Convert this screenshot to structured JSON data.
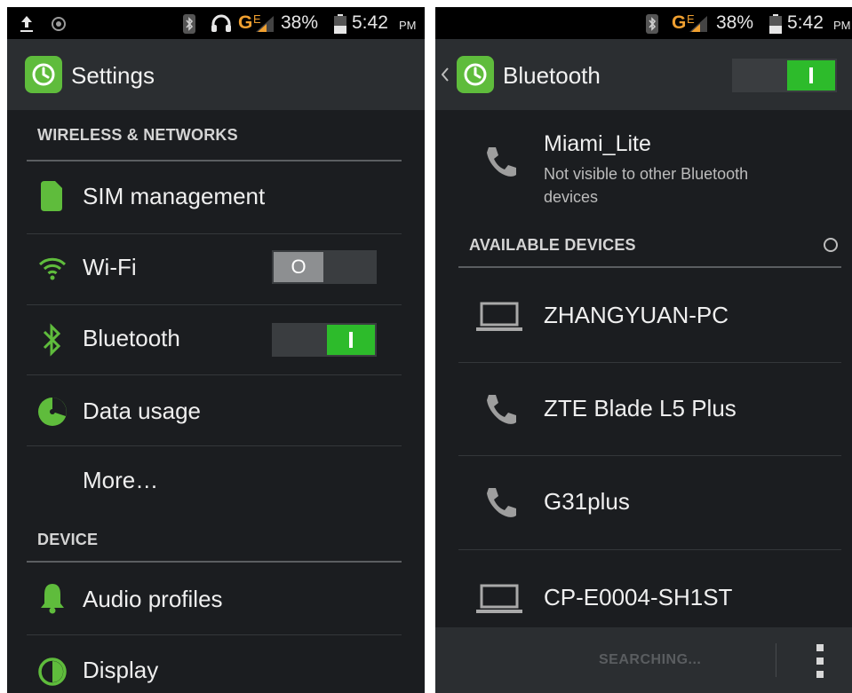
{
  "left": {
    "status": {
      "battery": "38%",
      "time": "5:42",
      "ampm": "PM",
      "network": "G",
      "network_sup": "E"
    },
    "title": "Settings",
    "sections": {
      "wireless": "WIRELESS & NETWORKS",
      "device": "DEVICE"
    },
    "items": {
      "sim": "SIM management",
      "wifi": "Wi-Fi",
      "bluetooth": "Bluetooth",
      "data": "Data usage",
      "more": "More…",
      "audio": "Audio profiles",
      "display": "Display"
    },
    "wifi_toggle_text": "O",
    "wifi_enabled": false,
    "bluetooth_enabled": true
  },
  "right": {
    "status": {
      "battery": "38%",
      "time": "5:42",
      "ampm": "PM",
      "network": "G",
      "network_sup": "E"
    },
    "title": "Bluetooth",
    "bluetooth_enabled": true,
    "this_device": {
      "name": "Miami_Lite",
      "subtitle_line1": "Not visible to other Bluetooth",
      "subtitle_line2": "devices"
    },
    "available_header": "AVAILABLE DEVICES",
    "devices": [
      {
        "name": "ZHANGYUAN-PC",
        "icon": "laptop-icon"
      },
      {
        "name": "ZTE Blade L5 Plus",
        "icon": "phone-icon"
      },
      {
        "name": "G31plus",
        "icon": "phone-icon"
      },
      {
        "name": "CP-E0004-SH1ST",
        "icon": "laptop-icon"
      }
    ],
    "searching_label": "SEARCHING..."
  },
  "colors": {
    "accent_green": "#5fbc3c",
    "toggle_on": "#2dbb2b",
    "background": "#1b1d20",
    "actionbar": "#2b2e31"
  }
}
